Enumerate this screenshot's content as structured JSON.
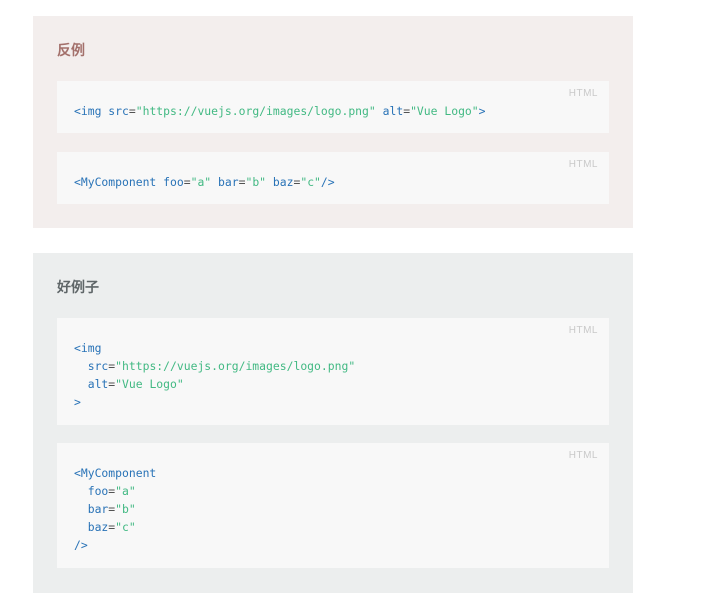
{
  "bad_example": {
    "title": "反例",
    "blocks": [
      {
        "lang": "HTML",
        "lines": [
          [
            {
              "type": "tag",
              "text": "<img "
            },
            {
              "type": "attr",
              "text": "src"
            },
            {
              "type": "punc",
              "text": "="
            },
            {
              "type": "val",
              "text": "\"https://vuejs.org/images/logo.png\""
            },
            {
              "type": "attr",
              "text": " alt"
            },
            {
              "type": "punc",
              "text": "="
            },
            {
              "type": "val",
              "text": "\"Vue Logo\""
            },
            {
              "type": "tag",
              "text": ">"
            }
          ]
        ]
      },
      {
        "lang": "HTML",
        "lines": [
          [
            {
              "type": "tag",
              "text": "<MyComponent "
            },
            {
              "type": "attr",
              "text": "foo"
            },
            {
              "type": "punc",
              "text": "="
            },
            {
              "type": "val",
              "text": "\"a\""
            },
            {
              "type": "attr",
              "text": " bar"
            },
            {
              "type": "punc",
              "text": "="
            },
            {
              "type": "val",
              "text": "\"b\""
            },
            {
              "type": "attr",
              "text": " baz"
            },
            {
              "type": "punc",
              "text": "="
            },
            {
              "type": "val",
              "text": "\"c\""
            },
            {
              "type": "tag",
              "text": "/>"
            }
          ]
        ]
      }
    ]
  },
  "good_example": {
    "title": "好例子",
    "blocks": [
      {
        "lang": "HTML",
        "lines": [
          [
            {
              "type": "tag",
              "text": "<img"
            }
          ],
          [
            {
              "type": "attr",
              "text": "  src"
            },
            {
              "type": "punc",
              "text": "="
            },
            {
              "type": "val",
              "text": "\"https://vuejs.org/images/logo.png\""
            }
          ],
          [
            {
              "type": "attr",
              "text": "  alt"
            },
            {
              "type": "punc",
              "text": "="
            },
            {
              "type": "val",
              "text": "\"Vue Logo\""
            }
          ],
          [
            {
              "type": "tag",
              "text": ">"
            }
          ]
        ]
      },
      {
        "lang": "HTML",
        "lines": [
          [
            {
              "type": "tag",
              "text": "<MyComponent"
            }
          ],
          [
            {
              "type": "attr",
              "text": "  foo"
            },
            {
              "type": "punc",
              "text": "="
            },
            {
              "type": "val",
              "text": "\"a\""
            }
          ],
          [
            {
              "type": "attr",
              "text": "  bar"
            },
            {
              "type": "punc",
              "text": "="
            },
            {
              "type": "val",
              "text": "\"b\""
            }
          ],
          [
            {
              "type": "attr",
              "text": "  baz"
            },
            {
              "type": "punc",
              "text": "="
            },
            {
              "type": "val",
              "text": "\"c\""
            }
          ],
          [
            {
              "type": "tag",
              "text": "/>"
            }
          ]
        ]
      }
    ]
  },
  "colors": {
    "bad_panel_bg": "#f3eeed",
    "bad_title": "#a3706b",
    "good_panel_bg": "#eceeee",
    "good_title": "#5f6668",
    "code_bg": "#f8f8f8",
    "tag": "#2973b7",
    "string": "#42b983"
  }
}
